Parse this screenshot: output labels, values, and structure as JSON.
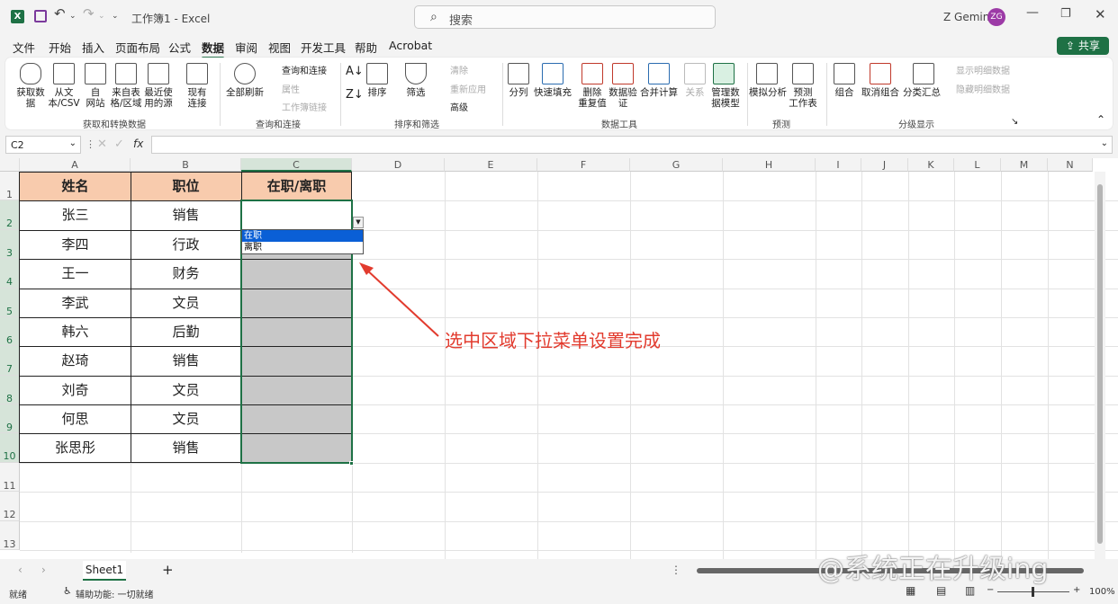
{
  "window": {
    "title": "工作簿1 - Excel",
    "user": "Z Gemini",
    "avatar_initials": "ZG",
    "search_placeholder": "搜索"
  },
  "menu": [
    "文件",
    "开始",
    "插入",
    "页面布局",
    "公式",
    "数据",
    "审阅",
    "视图",
    "开发工具",
    "帮助",
    "Acrobat"
  ],
  "menu_active": "数据",
  "share_label": "共享",
  "ribbon": {
    "get_transform": {
      "buttons": [
        "获取数\n据",
        "从文\n本/CSV",
        "自\n网站",
        "来自表\n格/区域",
        "最近使\n用的源",
        "现有\n连接"
      ],
      "group": "获取和转换数据"
    },
    "queries": {
      "big": "全部刷新",
      "small": [
        "查询和连接",
        "属性",
        "工作簿链接"
      ],
      "group": "查询和连接"
    },
    "sort_filter": {
      "buttons": [
        "排序",
        "筛选"
      ],
      "small": [
        "清除",
        "重新应用",
        "高级"
      ],
      "group": "排序和筛选"
    },
    "data_tools": {
      "buttons": [
        "分列",
        "快速填充",
        "删除\n重复值",
        "数据验\n证",
        "合并计算",
        "关系",
        "管理数\n据模型"
      ],
      "group": "数据工具"
    },
    "forecast": {
      "buttons": [
        "模拟分析",
        "预测\n工作表"
      ],
      "group": "预测"
    },
    "outline": {
      "buttons": [
        "组合",
        "取消组合",
        "分类汇总"
      ],
      "small": [
        "显示明细数据",
        "隐藏明细数据"
      ],
      "group": "分级显示"
    }
  },
  "formula_bar": {
    "name_box": "C2",
    "fx": "fx",
    "value": ""
  },
  "columns": [
    "A",
    "B",
    "C",
    "D",
    "E",
    "F",
    "G",
    "H",
    "I",
    "J",
    "K",
    "L",
    "M",
    "N"
  ],
  "rows": [
    "1",
    "2",
    "3",
    "4",
    "5",
    "6",
    "7",
    "8",
    "9",
    "10",
    "11",
    "12",
    "13"
  ],
  "table": {
    "headers": [
      "姓名",
      "职位",
      "在职/离职"
    ],
    "names": [
      "张三",
      "李四",
      "王一",
      "李武",
      "韩六",
      "赵琦",
      "刘奇",
      "何思",
      "张思彤"
    ],
    "positions": [
      "销售",
      "行政",
      "财务",
      "文员",
      "后勤",
      "销售",
      "文员",
      "文员",
      "销售"
    ]
  },
  "dropdown": {
    "options": [
      "在职",
      "离职"
    ],
    "highlighted": "在职"
  },
  "annotation": "选中区域下拉菜单设置完成",
  "sheet_tab": "Sheet1",
  "add_sheet": "+",
  "status": {
    "ready": "就绪",
    "accessibility": "辅助功能: 一切就绪",
    "zoom": "100%"
  },
  "watermark": "@系统正在升级ing",
  "colors": {
    "accent": "#1e7145",
    "header_fill": "#f8cbad",
    "selection_fill": "#c8c8c8",
    "annotation": "#e23b2e"
  }
}
